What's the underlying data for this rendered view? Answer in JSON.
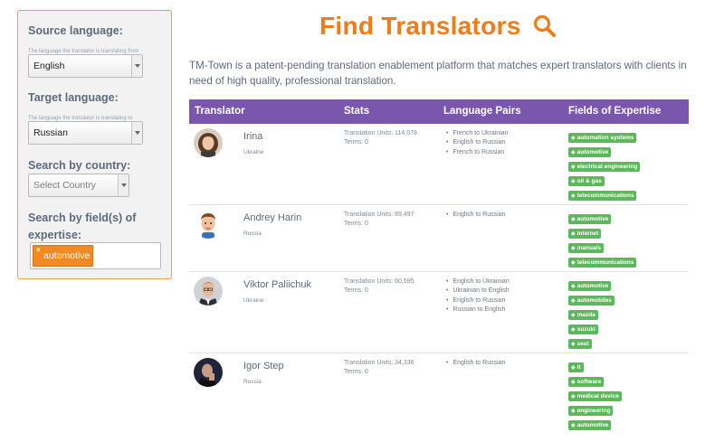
{
  "sidebar": {
    "source_label": "Source language:",
    "source_help": "The language the translator is translating from",
    "source_value": "English",
    "target_label": "Target language:",
    "target_help": "The language the translator is translating to",
    "target_value": "Russian",
    "country_label": "Search by country:",
    "country_placeholder": "Select Country",
    "fields_label_1": "Search by field(s) of",
    "fields_label_2": "expertise:",
    "fields_chip": "automotive",
    "chip_remove": "×"
  },
  "header": {
    "title": "Find Translators",
    "icon": "search-icon",
    "intro": "TM-Town is a patent-pending translation enablement platform that matches expert translators with clients in need of high quality, professional translation."
  },
  "table": {
    "columns": [
      "Translator",
      "Stats",
      "Language Pairs",
      "Fields of Expertise"
    ],
    "rows": [
      {
        "name": "Irina",
        "country": "Ukraine",
        "units": "Translation Units: 114,078",
        "terms": "Terms: 0",
        "pairs": [
          "French to Ukrainian",
          "English to Russian",
          "French to Russian"
        ],
        "tags": [
          "automation systems",
          "automotive",
          "electrical engineering",
          "oil & gas",
          "telecommunications"
        ]
      },
      {
        "name": "Andrey Harin",
        "country": "Russia",
        "units": "Translation Units: 89,497",
        "terms": "Terms: 0",
        "pairs": [
          "English to Russian"
        ],
        "tags": [
          "automotive",
          "internet",
          "manuals",
          "telecommunications"
        ]
      },
      {
        "name": "Viktor Paliichuk",
        "country": "Ukraine",
        "units": "Translation Units: 60,595",
        "terms": "Terms: 0",
        "pairs": [
          "English to Ukrainian",
          "Ukrainian to English",
          "English to Russian",
          "Russian to English"
        ],
        "tags": [
          "automotive",
          "automobiles",
          "mazda",
          "suzuki",
          "seat"
        ]
      },
      {
        "name": "Igor Step",
        "country": "Russia",
        "units": "Translation Units: 34,336",
        "terms": "Terms: 0",
        "pairs": [
          "English to Russian"
        ],
        "tags": [
          "it",
          "software",
          "medical device",
          "engineering",
          "automotive"
        ]
      }
    ]
  },
  "colors": {
    "accent": "#ef7c1b",
    "header_bg": "#7b56ad",
    "tag_bg": "#5cb85c",
    "chip_bg": "#f18a22"
  }
}
